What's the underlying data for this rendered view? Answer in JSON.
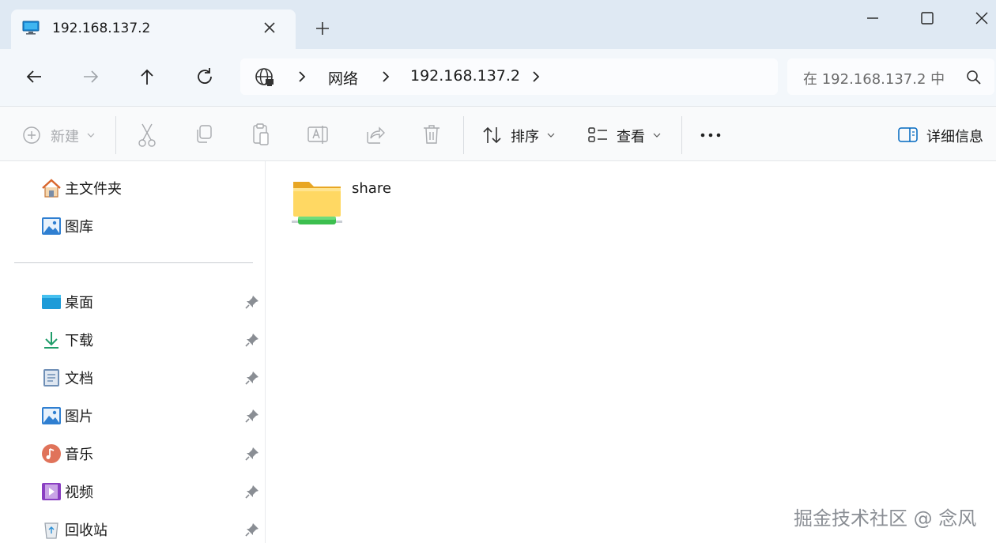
{
  "tab": {
    "title": "192.168.137.2",
    "icon": "computer-monitor-icon"
  },
  "window_controls": {
    "minimize": "minimize-icon",
    "maximize": "maximize-icon",
    "close": "close-icon"
  },
  "address": {
    "crumbs": [
      "网络",
      "192.168.137.2"
    ],
    "search_placeholder": "在 192.168.137.2 中"
  },
  "toolbar": {
    "new_label": "新建",
    "sort_label": "排序",
    "view_label": "查看",
    "details_label": "详细信息"
  },
  "sidebar": {
    "top": [
      {
        "label": "主文件夹",
        "icon": "home-icon"
      },
      {
        "label": "图库",
        "icon": "gallery-icon"
      }
    ],
    "pinned": [
      {
        "label": "桌面",
        "icon": "desktop-icon"
      },
      {
        "label": "下载",
        "icon": "download-icon"
      },
      {
        "label": "文档",
        "icon": "document-icon"
      },
      {
        "label": "图片",
        "icon": "pictures-icon"
      },
      {
        "label": "音乐",
        "icon": "music-icon"
      },
      {
        "label": "视频",
        "icon": "video-icon"
      },
      {
        "label": "回收站",
        "icon": "recycle-bin-icon"
      }
    ]
  },
  "content": {
    "items": [
      {
        "name": "share",
        "icon": "network-share-folder-icon"
      }
    ]
  },
  "watermark": "掘金技术社区 @ 念风",
  "colors": {
    "titlebar": "#dfe9f3",
    "navbar": "#f3f7fb",
    "accent": "#0067c0",
    "folder": "#f5c542",
    "share_bar": "#3cbf4f"
  }
}
